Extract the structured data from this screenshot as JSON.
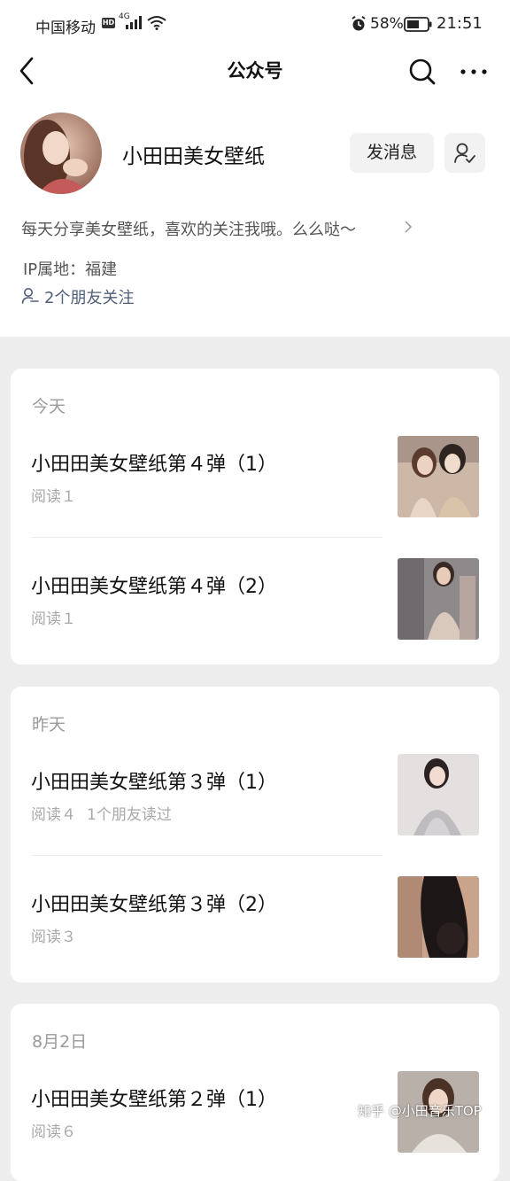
{
  "status_bar": {
    "carrier": "中国移动",
    "hd": "HD",
    "network": "4G",
    "battery": "58%",
    "time": "21:51"
  },
  "nav": {
    "title": "公众号"
  },
  "profile": {
    "name": "小田田美女壁纸",
    "message_button": "发消息",
    "description": "每天分享美女壁纸，喜欢的关注我哦。么么哒～",
    "ip_location": "IP属地：福建",
    "friends_following": "2个朋友关注"
  },
  "groups": [
    {
      "label": "今天",
      "articles": [
        {
          "title": "小田田美女壁纸第４弹（1）",
          "reads": "阅读１",
          "friends_read": ""
        },
        {
          "title": "小田田美女壁纸第４弹（2）",
          "reads": "阅读１",
          "friends_read": ""
        }
      ]
    },
    {
      "label": "昨天",
      "articles": [
        {
          "title": "小田田美女壁纸第３弹（1）",
          "reads": "阅读４",
          "friends_read": "1个朋友读过"
        },
        {
          "title": "小田田美女壁纸第３弹（2）",
          "reads": "阅读３",
          "friends_read": ""
        }
      ]
    },
    {
      "label": "8月2日",
      "articles": [
        {
          "title": "小田田美女壁纸第２弹（1）",
          "reads": "阅读６",
          "friends_read": ""
        }
      ]
    }
  ],
  "watermark": "知乎 @小田音乐TOP",
  "colors": {
    "page_bg": "#ededed",
    "link": "#50607a",
    "muted": "#a8a8a8"
  }
}
